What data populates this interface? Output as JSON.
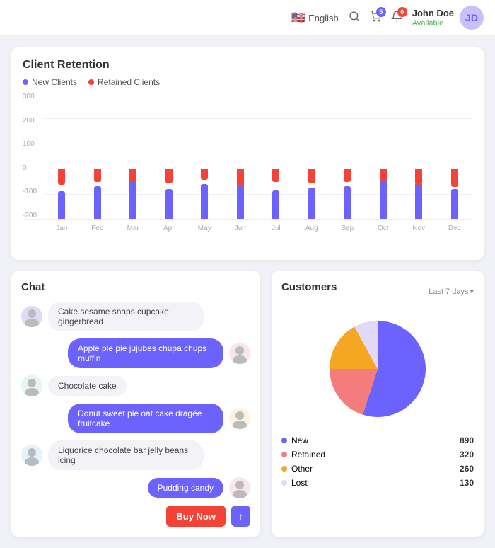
{
  "header": {
    "lang": "English",
    "cart_badge": "5",
    "notif_badge": "0",
    "user_name": "John Doe",
    "user_status": "Available"
  },
  "client_retention": {
    "title": "Client Retention",
    "legend_new": "New Clients",
    "legend_retained": "Retained Clients",
    "months": [
      "Jan",
      "Feb",
      "Mar",
      "Apr",
      "May",
      "Jun",
      "Jul",
      "Aug",
      "Sep",
      "Oct",
      "Nov",
      "Dec"
    ],
    "y_labels": [
      "300",
      "200",
      "100",
      "0",
      "-100",
      "-200"
    ],
    "bars": [
      {
        "blue": 110,
        "red": 60
      },
      {
        "blue": 130,
        "red": 50
      },
      {
        "blue": 190,
        "red": 45
      },
      {
        "blue": 120,
        "red": 55
      },
      {
        "blue": 140,
        "red": 40
      },
      {
        "blue": 160,
        "red": 65
      },
      {
        "blue": 115,
        "red": 50
      },
      {
        "blue": 125,
        "red": 55
      },
      {
        "blue": 130,
        "red": 48
      },
      {
        "blue": 185,
        "red": 42
      },
      {
        "blue": 145,
        "red": 60
      },
      {
        "blue": 120,
        "red": 68
      }
    ]
  },
  "chat": {
    "title": "Chat",
    "messages": [
      {
        "text": "Cake sesame snaps cupcake gingerbread",
        "type": "received",
        "avatar": "A1"
      },
      {
        "text": "Apple pie pie jujubes chupa chups muffin",
        "type": "sent",
        "avatar": "A2"
      },
      {
        "text": "Chocolate cake",
        "type": "received",
        "avatar": "A3"
      },
      {
        "text": "Donut sweet pie oat cake dragée fruitcake",
        "type": "sent",
        "avatar": "A4"
      },
      {
        "text": "Liquorice chocolate bar jelly beans icing",
        "type": "received",
        "avatar": "A5"
      },
      {
        "text": "Pudding candy",
        "type": "sent",
        "avatar": "A6"
      }
    ],
    "buy_now": "Buy Now",
    "scroll_up": "↑"
  },
  "customers": {
    "title": "Customers",
    "period": "Last 7 days",
    "pie": [
      {
        "label": "New",
        "value": 890,
        "color": "#6c63ff",
        "percent": 55
      },
      {
        "label": "Retained",
        "value": 320,
        "color": "#f47c7c",
        "percent": 20
      },
      {
        "label": "Other",
        "value": 260,
        "color": "#f5a623",
        "percent": 17
      },
      {
        "label": "Lost",
        "value": 130,
        "color": "#e0daf8",
        "percent": 8
      }
    ]
  }
}
